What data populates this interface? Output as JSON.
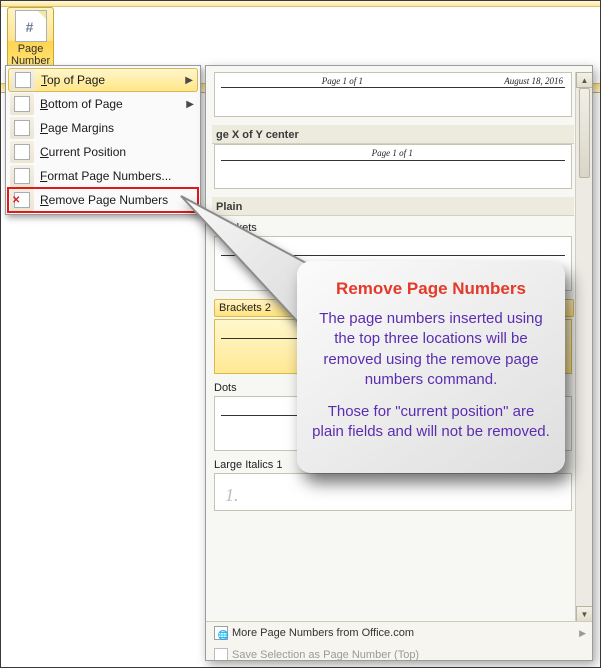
{
  "ribbon": {
    "page_number_label_1": "Page",
    "page_number_label_2": "Number",
    "dropdown_glyph": "▾"
  },
  "menu": {
    "items": [
      {
        "label": "Top of Page",
        "accel": "T",
        "submenu": true,
        "highlight": true,
        "icon": "page-top-icon"
      },
      {
        "label": "Bottom of Page",
        "accel": "B",
        "submenu": true,
        "icon": "page-bottom-icon"
      },
      {
        "label": "Page Margins",
        "accel": "P",
        "icon": "page-margins-icon"
      },
      {
        "label": "Current Position",
        "accel": "C",
        "icon": "current-position-icon"
      },
      {
        "label": "Format Page Numbers...",
        "accel": "F",
        "icon": "format-page-numbers-icon"
      },
      {
        "label": "Remove Page Numbers",
        "accel": "R",
        "icon": "remove-page-numbers-icon",
        "boxed": true
      }
    ]
  },
  "gallery": {
    "preview1_left": "Page 1 of 1",
    "preview1_right": "August 18, 2016",
    "cat2": "ge X of Y center",
    "preview2_center": "Page 1 of 1",
    "cat_plain": "Plain",
    "item_brackets1": "Brackets",
    "item_brackets2": "Brackets 2",
    "item_dots": "Dots",
    "item_large_italics": "Large Italics 1",
    "large_italics_value": "1.",
    "footer_more": "More Page Numbers from Office.com",
    "footer_save": "Save Selection as Page Number (Top)"
  },
  "callout": {
    "title": "Remove Page Numbers",
    "para1": "The page numbers inserted using the top three locations will be removed using the remove page numbers command.",
    "para2": "Those for \"current position\" are plain fields and will not be removed."
  }
}
